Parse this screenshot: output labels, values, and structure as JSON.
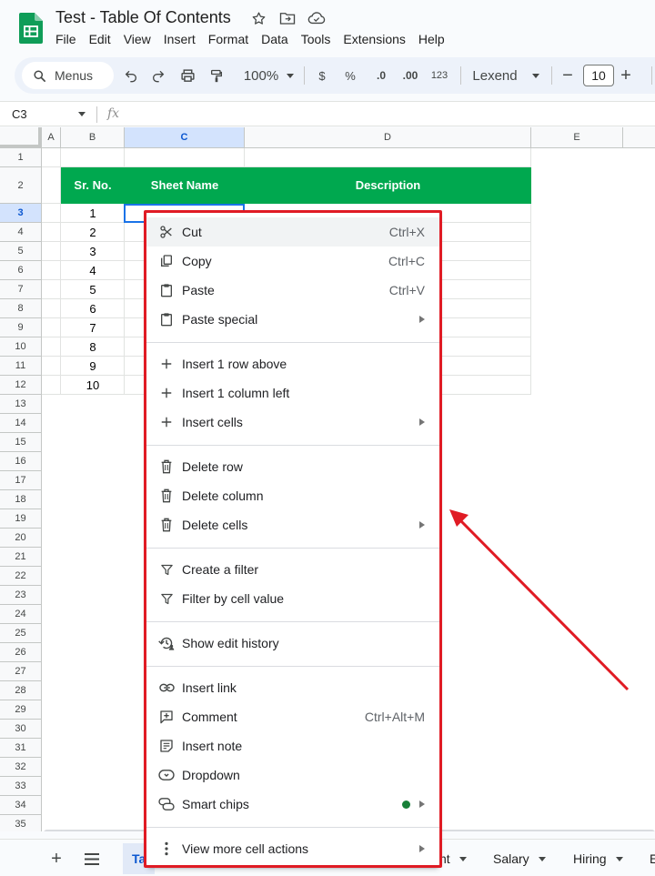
{
  "header": {
    "title": "Test - Table Of Contents",
    "menus": [
      "File",
      "Edit",
      "View",
      "Insert",
      "Format",
      "Data",
      "Tools",
      "Extensions",
      "Help"
    ]
  },
  "toolbar": {
    "search_label": "Menus",
    "zoom": "100%",
    "currency": "$",
    "percent": "%",
    "dec_decrease": ".0",
    "dec_increase": ".00",
    "number_format": "123",
    "font": "Lexend",
    "minus": "−",
    "font_size": "10",
    "plus": "+"
  },
  "formula_bar": {
    "cell_ref": "C3",
    "fx": "fx"
  },
  "grid": {
    "columns": [
      "A",
      "B",
      "C",
      "D",
      "E"
    ],
    "rows": [
      "1",
      "2",
      "3",
      "4",
      "5",
      "6",
      "7",
      "8",
      "9",
      "10",
      "11",
      "12",
      "13",
      "14",
      "15",
      "16",
      "17",
      "18",
      "19",
      "20",
      "21",
      "22",
      "23",
      "24",
      "25",
      "26",
      "27",
      "28",
      "29",
      "30",
      "31",
      "32",
      "33",
      "34",
      "35"
    ],
    "table_headers": {
      "sr_no": "Sr. No.",
      "sheet_name": "Sheet Name",
      "description": "Description"
    },
    "sr_numbers": [
      "1",
      "2",
      "3",
      "4",
      "5",
      "6",
      "7",
      "8",
      "9",
      "10"
    ]
  },
  "sheetbar": {
    "tabs": [
      {
        "label": "Ta"
      },
      {
        "label": "nt"
      },
      {
        "label": "Salary"
      },
      {
        "label": "Hiring"
      },
      {
        "label": "E"
      }
    ]
  },
  "context_menu": {
    "items": [
      {
        "label": "Cut",
        "shortcut": "Ctrl+X",
        "icon": "scissors-icon"
      },
      {
        "label": "Copy",
        "shortcut": "Ctrl+C",
        "icon": "copy-icon"
      },
      {
        "label": "Paste",
        "shortcut": "Ctrl+V",
        "icon": "clipboard-icon"
      },
      {
        "label": "Paste special",
        "shortcut": "",
        "icon": "clipboard-icon"
      },
      {
        "label": "Insert 1 row above",
        "shortcut": "",
        "icon": "plus-icon"
      },
      {
        "label": "Insert 1 column left",
        "shortcut": "",
        "icon": "plus-icon"
      },
      {
        "label": "Insert cells",
        "shortcut": "",
        "icon": "plus-icon"
      },
      {
        "label": "Delete row",
        "shortcut": "",
        "icon": "trash-icon"
      },
      {
        "label": "Delete column",
        "shortcut": "",
        "icon": "trash-icon"
      },
      {
        "label": "Delete cells",
        "shortcut": "",
        "icon": "trash-icon"
      },
      {
        "label": "Create a filter",
        "shortcut": "",
        "icon": "filter-icon"
      },
      {
        "label": "Filter by cell value",
        "shortcut": "",
        "icon": "filter-icon"
      },
      {
        "label": "Show edit history",
        "shortcut": "",
        "icon": "history-icon"
      },
      {
        "label": "Insert link",
        "shortcut": "",
        "icon": "link-icon"
      },
      {
        "label": "Comment",
        "shortcut": "Ctrl+Alt+M",
        "icon": "comment-icon"
      },
      {
        "label": "Insert note",
        "shortcut": "",
        "icon": "note-icon"
      },
      {
        "label": "Dropdown",
        "shortcut": "",
        "icon": "dropdown-icon"
      },
      {
        "label": "Smart chips",
        "shortcut": "",
        "icon": "smart-chip-icon"
      },
      {
        "label": "View more cell actions",
        "shortcut": "",
        "icon": "more-vert-icon"
      }
    ]
  },
  "colors": {
    "table_header_bg": "#00a84f",
    "annotation": "#e01b24",
    "selection": "#1a73e8"
  }
}
